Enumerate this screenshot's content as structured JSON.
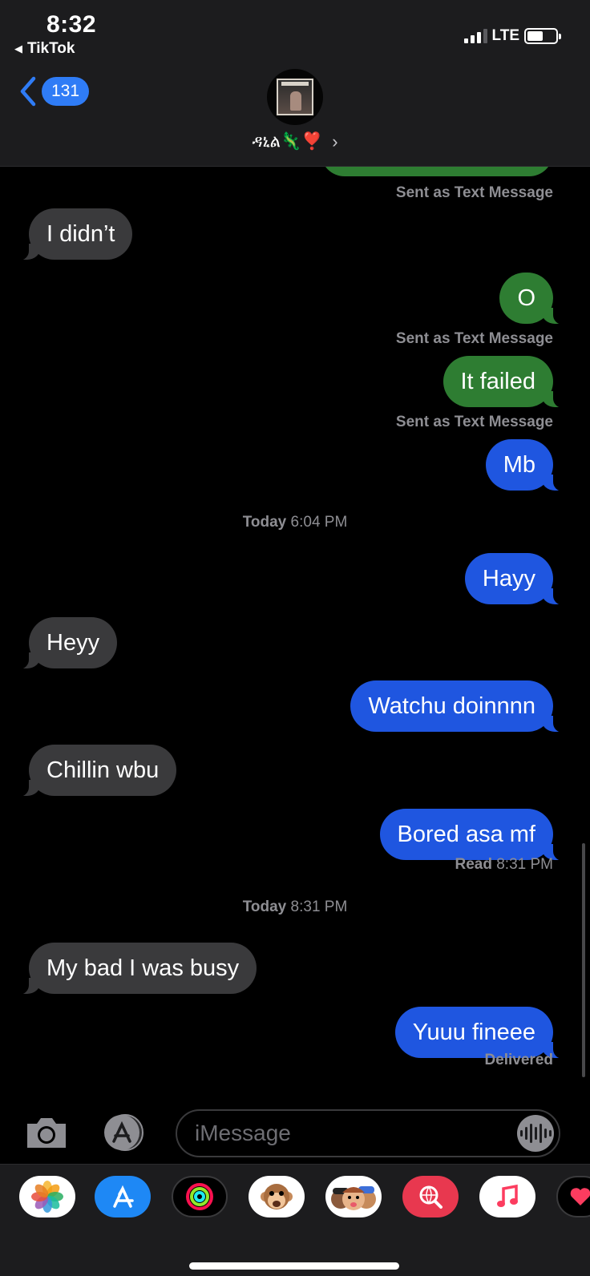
{
  "status_bar": {
    "time": "8:32",
    "back_app": "TikTok",
    "network": "LTE",
    "signal_bars": 3,
    "battery_level": 0.55
  },
  "header": {
    "unread_count": "131",
    "contact_name": "ዳኒል🦎❣️",
    "avatar_icon": "album-cover-avatar"
  },
  "messages": {
    "sent_as_text_1": "Sent as Text Message",
    "m1": "I didn’t",
    "m2": "O",
    "sent_as_text_2": "Sent as Text Message",
    "m3": "It failed",
    "sent_as_text_3": "Sent as Text Message",
    "m4": "Mb",
    "stamp1_day": "Today",
    "stamp1_time": "6:04 PM",
    "m5": "Hayy",
    "m6": "Heyy",
    "m7": "Watchu doinnnn",
    "m8": "Chillin wbu",
    "m9": "Bored asa mf",
    "read_label": "Read",
    "read_time": "8:31 PM",
    "stamp2_day": "Today",
    "stamp2_time": "8:31 PM",
    "m10": "My bad I was busy",
    "m11": "Yuuu fineee",
    "delivered": "Delivered"
  },
  "input": {
    "placeholder": "iMessage"
  },
  "colors": {
    "sms_green": "#2e7d32",
    "imessage_blue": "#1f56e0",
    "incoming_gray": "#3a3a3c",
    "badge_blue": "#2f7cf6"
  },
  "drawer_apps": [
    "photos-app-icon",
    "app-store-icon",
    "activity-icon",
    "animoji-icon",
    "memoji-icon",
    "web-search-icon",
    "music-icon",
    "digital-touch-icon"
  ]
}
